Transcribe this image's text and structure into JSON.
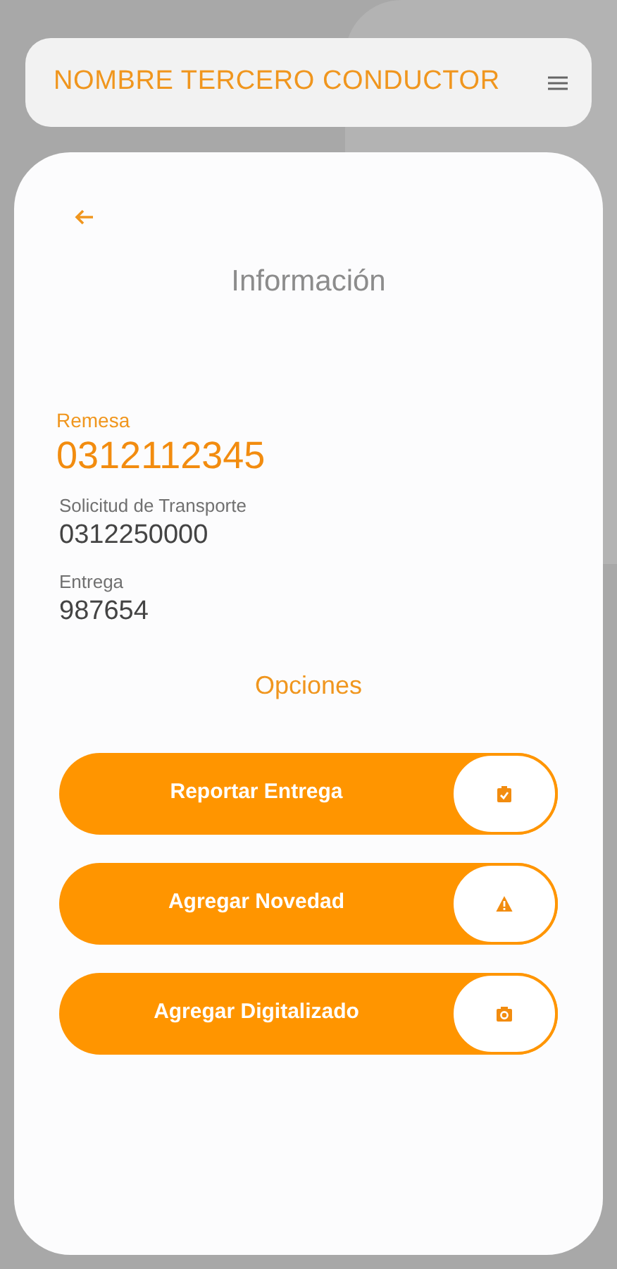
{
  "header": {
    "title": "NOMBRE TERCERO CONDUCTOR"
  },
  "card": {
    "title": "Información",
    "remesa": {
      "label": "Remesa",
      "value": "0312112345"
    },
    "fields": [
      {
        "label": "Solicitud de Transporte",
        "value": "0312250000"
      },
      {
        "label": "Entrega",
        "value": "987654"
      }
    ],
    "options_title": "Opciones",
    "actions": [
      {
        "label": "Reportar Entrega",
        "kind": "report"
      },
      {
        "label": "Agregar Novedad",
        "kind": "alert"
      },
      {
        "label": "Agregar Digitalizado",
        "kind": "camera"
      }
    ]
  }
}
